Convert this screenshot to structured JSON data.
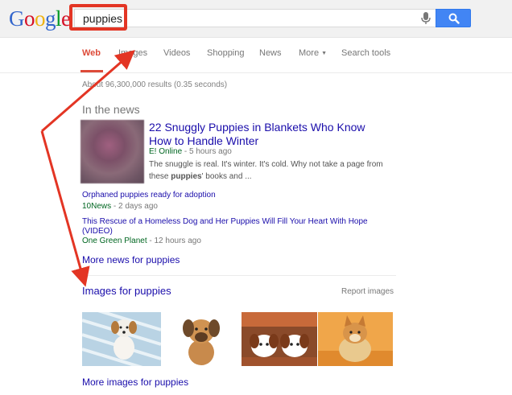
{
  "header": {
    "logo_letters": [
      "G",
      "o",
      "o",
      "g",
      "l",
      "e"
    ],
    "search_value": "puppies"
  },
  "tabs": [
    {
      "label": "Web",
      "active": true
    },
    {
      "label": "Images",
      "active": false
    },
    {
      "label": "Videos",
      "active": false
    },
    {
      "label": "Shopping",
      "active": false
    },
    {
      "label": "News",
      "active": false
    },
    {
      "label": "More",
      "active": false
    },
    {
      "label": "Search tools",
      "active": false
    }
  ],
  "results_stats": "About 96,300,000 results (0.35 seconds)",
  "in_the_news": {
    "heading": "In the news",
    "top_story": {
      "title": "22 Snuggly Puppies in Blankets Who Know How to Handle Winter",
      "source": "E! Online",
      "time": " - 5 hours ago",
      "snippet_pre": "The snuggle is real. It's winter. It's cold. Why not take a page from these ",
      "snippet_bold": "puppies",
      "snippet_post": "' books and ..."
    },
    "stories": [
      {
        "title": "Orphaned puppies ready for adoption",
        "source": "10News",
        "time": " - 2 days ago"
      },
      {
        "title": "This Rescue of a Homeless Dog and Her Puppies Will Fill Your Heart With Hope (VIDEO)",
        "source": "One Green Planet",
        "time": " - 12 hours ago"
      }
    ],
    "more_link": "More news for puppies"
  },
  "images_section": {
    "heading": "Images for puppies",
    "report": "Report images",
    "more_link": "More images for puppies"
  },
  "colors": {
    "link": "#1a0dab",
    "source": "#006621",
    "active_tab": "#dd4b39",
    "annotation": "#e33524",
    "search_button": "#4285f4"
  }
}
